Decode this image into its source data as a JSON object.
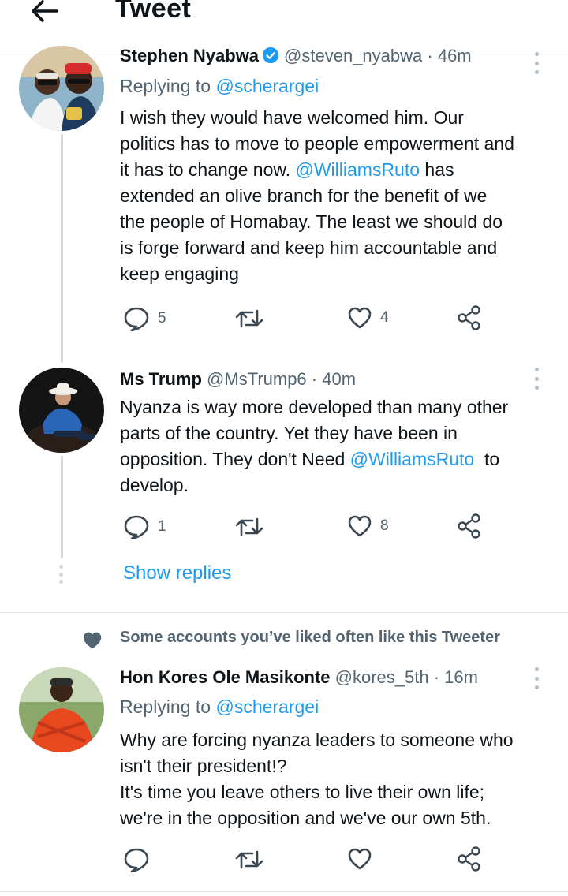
{
  "header": {
    "title": "Tweet"
  },
  "tweets": [
    {
      "name": "Stephen Nyabwa",
      "handle": "@steven_nyabwa",
      "time": "· 46m",
      "replying_prefix": "Replying to",
      "replying_to": "@scherargei",
      "body_lines": [
        "I wish they would have welcomed him. Our",
        "politics has to move to people empowerment and",
        "it has to change now.",
        "@WilliamsRuto",
        " has",
        "extended an olive branch for the benefit of we",
        "the people of Homabay. The least we should do",
        "is forge forward and keep him accountable and",
        "keep engaging"
      ],
      "replies": "5",
      "retweets": "",
      "likes": "4"
    },
    {
      "name": "Ms Trump",
      "handle": "@MsTrump6",
      "time": "· 40m",
      "body_lines": [
        "Nyanza is way more developed than many other",
        "parts of the country. Yet they have been in",
        "opposition. They don't Need",
        "@WilliamsRuto",
        "  to",
        "develop."
      ],
      "replies": "1",
      "retweets": "",
      "likes": "8"
    },
    {
      "name": "Hon Kores Ole Masikonte",
      "handle": "@kores_5th",
      "time": "· 16m",
      "replying_prefix": "Replying to",
      "replying_to": "@scherargei",
      "body_lines": [
        "Why are forcing nyanza leaders to someone who",
        "isn't their president!?",
        "It's time you leave others to live their own life;",
        "we're in the opposition and we've our own 5th."
      ],
      "replies": "",
      "retweets": "",
      "likes": ""
    }
  ],
  "show_replies": "Show replies",
  "social_context": "Some accounts you’ve liked often like this Tweeter",
  "icons": {
    "back": "arrow-left-icon",
    "verified": "verified-badge-icon",
    "reply": "reply-bubble-icon",
    "retweet": "retweet-icon",
    "like": "heart-outline-icon",
    "share": "share-nodes-icon",
    "more": "vertical-dots-icon",
    "context": "heart-filled-icon"
  },
  "colors": {
    "accent": "#1d9bf0",
    "text": "#0f1419",
    "secondary": "#536471",
    "thread_line": "#cfd9de"
  }
}
